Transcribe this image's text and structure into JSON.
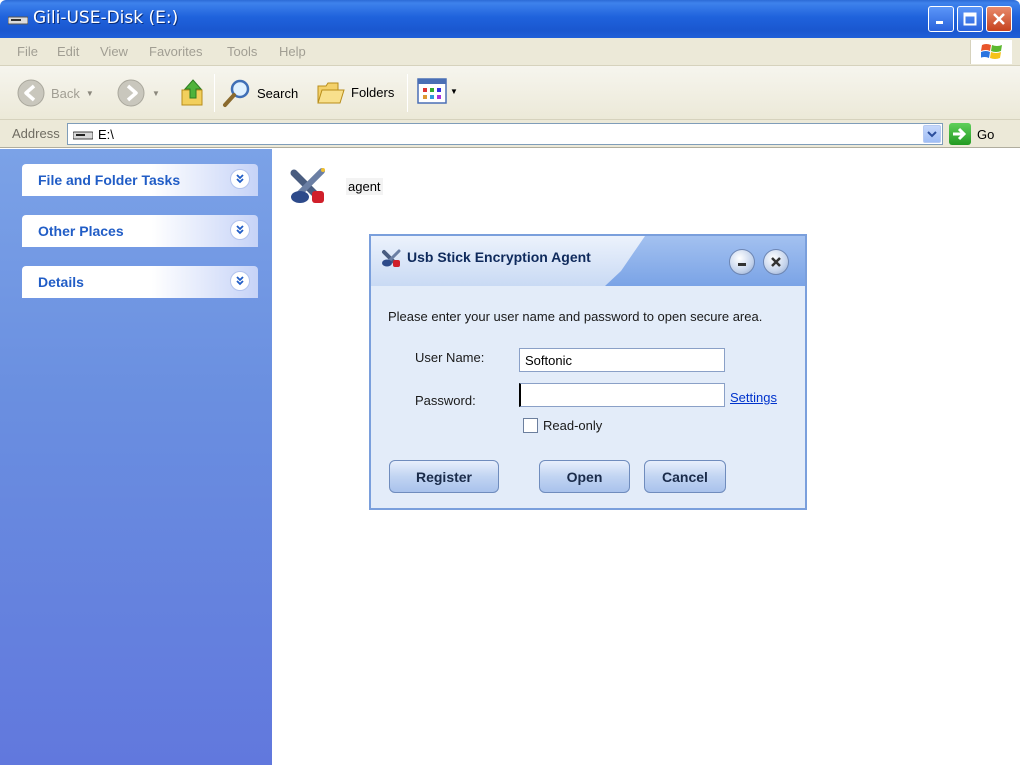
{
  "window": {
    "title": "Gili-USE-Disk (E:)"
  },
  "menu": {
    "items": [
      "File",
      "Edit",
      "View",
      "Favorites",
      "Tools",
      "Help"
    ]
  },
  "toolbar": {
    "back_label": "Back",
    "search_label": "Search",
    "folders_label": "Folders"
  },
  "address": {
    "label": "Address",
    "value": "E:\\",
    "go_label": "Go"
  },
  "taskpane": {
    "panels": [
      {
        "title": "File and Folder Tasks"
      },
      {
        "title": "Other Places"
      },
      {
        "title": "Details"
      }
    ]
  },
  "content": {
    "files": [
      {
        "name": "agent"
      }
    ]
  },
  "dialog": {
    "title": "Usb Stick Encryption Agent",
    "prompt": "Please enter your user name and password to open secure area.",
    "username_label": "User Name:",
    "username_value": "Softonic",
    "password_label": "Password:",
    "password_value": "",
    "settings_link": "Settings",
    "readonly_label": "Read-only",
    "readonly_checked": false,
    "register_label": "Register",
    "open_label": "Open",
    "cancel_label": "Cancel"
  },
  "colors": {
    "titlebar": "#1f62dc",
    "taskpane": "#6a8fe0",
    "panel_title": "#215dc6",
    "dialog_bg": "#e3ecf9",
    "link": "#0033cc"
  }
}
